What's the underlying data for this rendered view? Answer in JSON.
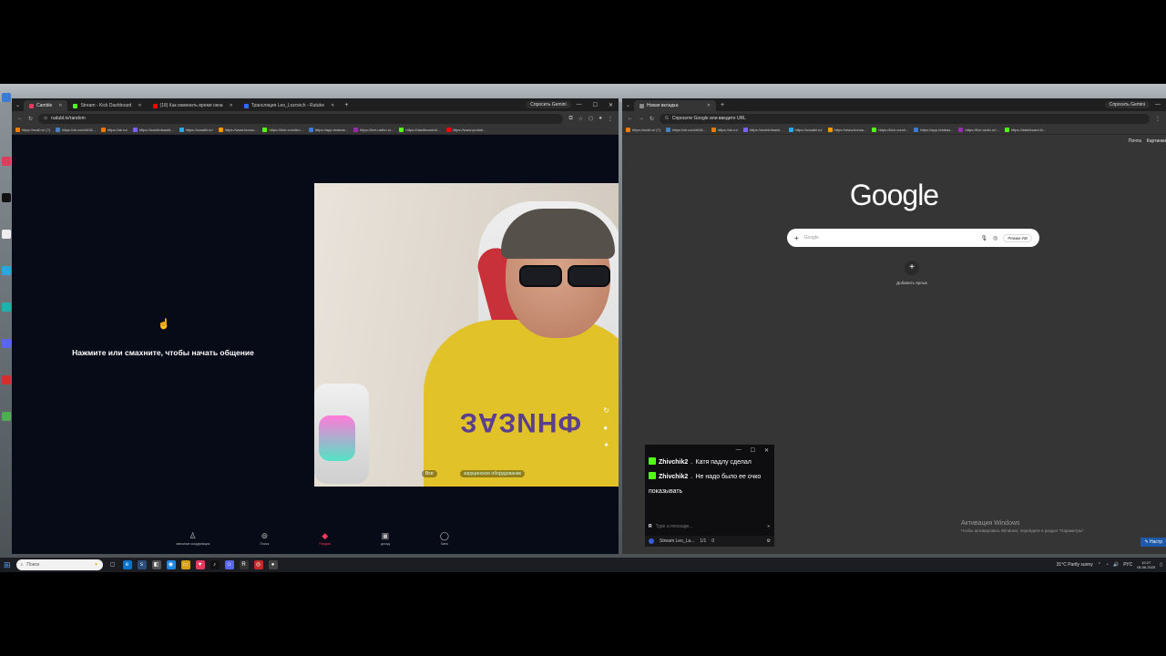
{
  "left_browser": {
    "tabs": [
      {
        "label": "Camble",
        "active": true,
        "color": "#e33b5c"
      },
      {
        "label": "Stream - Kick Dashboard",
        "active": false,
        "color": "#53fc18"
      },
      {
        "label": "(18) Как изменить время окна",
        "active": false,
        "color": "#ff0000"
      },
      {
        "label": "Трансляция Leo_Lozovich - Rutube",
        "active": false,
        "color": "#2c6bff"
      }
    ],
    "gemini": "Спросить Gemini",
    "url": "rudubl.tv/random",
    "bookmarks": [
      "https://mail.ru/ (?)",
      "https://vk.com/id18...",
      "https://ok.ru/",
      "https://worldofsankt...",
      "https://sosalki.ru/",
      "https://www.bonus...",
      "https://kick.com/leo...",
      "https://app.resteas...",
      "https://live-radio.ru/...",
      "https://dashboard.ki...",
      "https://www.youtub..."
    ],
    "prompt_icon": "tap-hand-icon",
    "prompt_text": "Нажмите или смахните, чтобы начать общение",
    "video_badge": "Все",
    "video_badge2": "заруцинское оборудование",
    "shirt_text": "ЗАЗИНФ",
    "nav": [
      {
        "icon": "users-icon",
        "label": "смешные координация",
        "active": false,
        "glyph": "♙"
      },
      {
        "icon": "search-icon",
        "label": "Поиск",
        "active": false,
        "glyph": "⊚"
      },
      {
        "icon": "random-icon",
        "label": "Рандом",
        "active": true,
        "glyph": "◆"
      },
      {
        "icon": "wallet-icon",
        "label": "доход",
        "active": false,
        "glyph": "▣"
      },
      {
        "icon": "chat-icon",
        "label": "Чаты",
        "active": false,
        "glyph": "◯"
      }
    ]
  },
  "right_browser": {
    "tab_label": "Новая вкладка",
    "gemini": "Спросить Gemini",
    "url_placeholder": "Спросите Google или введите URL",
    "bookmarks": [
      "https://mail.ru/ (?)",
      "https://vk.com/id18...",
      "https://ok.ru/",
      "https://worldofsank...",
      "https://sosalki.ru/",
      "https://www.bonus...",
      "https://kick.com/l...",
      "https://app.resteas...",
      "https://live-radio.ru/...",
      "https://dashboard.ki..."
    ],
    "top_links": [
      "Почта",
      "Картинки"
    ],
    "logo": "Google",
    "search_placeholder": "Google",
    "ai_mode": "Режим ИИ",
    "shortcut_label": "Добавить ярлык",
    "activation_title": "Активация Windows",
    "activation_sub": "Чтобы активировать Windows, перейдите в раздел \"Параметры\".",
    "settings_btn": "Настр"
  },
  "chat_overlay": {
    "messages": [
      {
        "user": "Zhivchik2",
        "text": "Катя падлу сделал"
      },
      {
        "user": "Zhivchik2",
        "text": "Не надо было ее очко показывать"
      }
    ],
    "input_placeholder": "Type a message...",
    "input_prefix": "R",
    "stream_label": "Stream Leo_La...",
    "stats": [
      "1/1",
      "0"
    ]
  },
  "taskbar": {
    "search_placeholder": "Поиск",
    "weather": "31°C  Partly sunny",
    "lang": "РУС",
    "time": "19:27",
    "date": "06.06.2025"
  }
}
